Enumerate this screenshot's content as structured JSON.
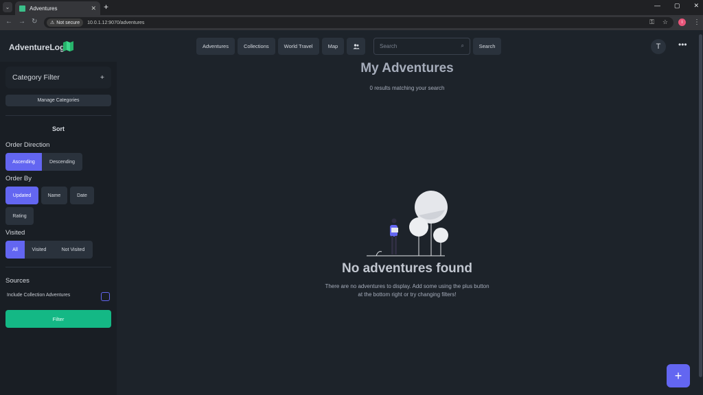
{
  "browser": {
    "tab_title": "Adventures",
    "secure_label": "Not secure",
    "url": "10.0.1.12:9070/adventures",
    "profile_initial": "I"
  },
  "navbar": {
    "brand": "AdventureLog",
    "buttons": [
      "Adventures",
      "Collections",
      "World Travel",
      "Map"
    ],
    "search_placeholder": "Search",
    "search_button": "Search",
    "avatar_initial": "T"
  },
  "sidebar": {
    "category_filter": "Category Filter",
    "category_add": "+",
    "manage_categories": "Manage Categories",
    "sort_title": "Sort",
    "order_direction_label": "Order Direction",
    "order_direction": [
      "Ascending",
      "Descending"
    ],
    "order_by_label": "Order By",
    "order_by": [
      "Updated",
      "Name",
      "Date",
      "Rating"
    ],
    "visited_label": "Visited",
    "visited": [
      "All",
      "Visited",
      "Not Visited"
    ],
    "sources_label": "Sources",
    "include_collection": "Include Collection Adventures",
    "filter_button": "Filter"
  },
  "main": {
    "title": "My Adventures",
    "subtitle": "0 results matching your search",
    "empty_title": "No adventures found",
    "empty_text": "There are no adventures to display. Add some using the plus button at the bottom right or try changing filters!",
    "fab": "+"
  },
  "colors": {
    "accent": "#6366f1",
    "success": "#14b885",
    "background": "#1d232a",
    "sidebar": "#191e24"
  }
}
